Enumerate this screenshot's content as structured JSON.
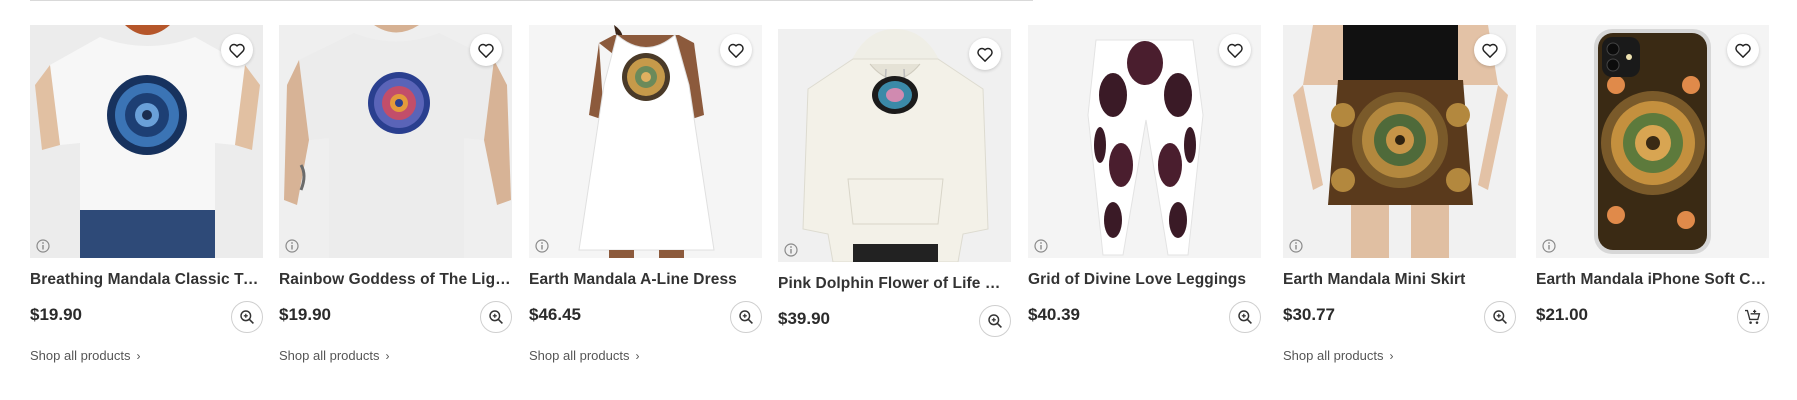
{
  "products": [
    {
      "title": "Breathing Mandala Classic T-S...",
      "price": "$19.90",
      "shop_link": "Shop all products",
      "action_icon": "zoom-in-icon"
    },
    {
      "title": "Rainbow Goddess of The Light...",
      "price": "$19.90",
      "shop_link": "Shop all products",
      "action_icon": "zoom-in-icon"
    },
    {
      "title": "Earth Mandala A-Line Dress",
      "price": "$46.45",
      "shop_link": "Shop all products",
      "action_icon": "zoom-in-icon"
    },
    {
      "title": "Pink Dolphin Flower of Life Ma...",
      "price": "$39.90",
      "shop_link": "",
      "action_icon": "zoom-in-icon"
    },
    {
      "title": "Grid of Divine Love Leggings",
      "price": "$40.39",
      "shop_link": "",
      "action_icon": "zoom-in-icon"
    },
    {
      "title": "Earth Mandala Mini Skirt",
      "price": "$30.77",
      "shop_link": "Shop all products",
      "action_icon": "zoom-in-icon"
    },
    {
      "title": "Earth Mandala iPhone Soft Case",
      "price": "$21.00",
      "shop_link": "",
      "action_icon": "add-to-cart-icon"
    }
  ],
  "colors": {
    "text": "#333333",
    "card_background": "#f4f4f4",
    "mandala_blue": "#2f5fa0",
    "mandala_earth": "#b87a3a"
  }
}
